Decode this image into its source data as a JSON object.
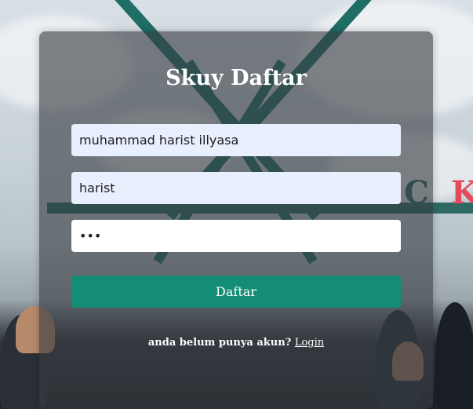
{
  "form": {
    "title": "Skuy Daftar",
    "fullname_value": "muhammad harist illyasa",
    "username_value": "harist",
    "password_value": "•••",
    "submit_label": "Daftar",
    "footer_text": "anda belum punya akun?",
    "login_link": "Login"
  },
  "colors": {
    "submit_button": "#138d75",
    "autofill_field": "#e8effd",
    "card_overlay": "#373c40"
  }
}
